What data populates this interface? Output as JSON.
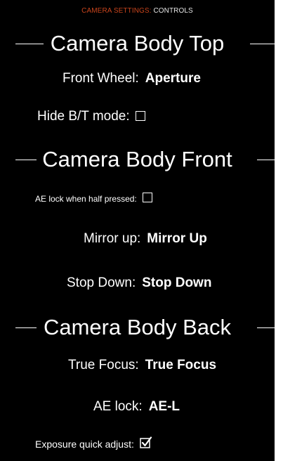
{
  "header": {
    "section": "CAMERA SETTINGS:",
    "current": "CONTROLS",
    "accent_color": "#c8441c"
  },
  "sections": {
    "top": {
      "title": "Camera Body Top"
    },
    "front": {
      "title": "Camera Body Front"
    },
    "back": {
      "title": "Camera Body Back"
    }
  },
  "settings": {
    "front_wheel": {
      "label": "Front Wheel:",
      "value": "Aperture"
    },
    "hide_bt_mode": {
      "label": "Hide B/T mode:",
      "checked": false
    },
    "ae_lock_half_pressed": {
      "label": "AE lock when half pressed:",
      "checked": false
    },
    "mirror_up": {
      "label": "Mirror up:",
      "value": "Mirror Up"
    },
    "stop_down": {
      "label": "Stop Down:",
      "value": "Stop Down"
    },
    "true_focus": {
      "label": "True Focus:",
      "value": "True Focus"
    },
    "ae_lock": {
      "label": "AE lock:",
      "value": "AE-L"
    },
    "exposure_quick_adjust": {
      "label": "Exposure quick adjust:",
      "checked": true
    }
  },
  "icons": {
    "unchecked": "checkbox-unchecked-icon",
    "checked": "checkbox-checked-icon"
  }
}
